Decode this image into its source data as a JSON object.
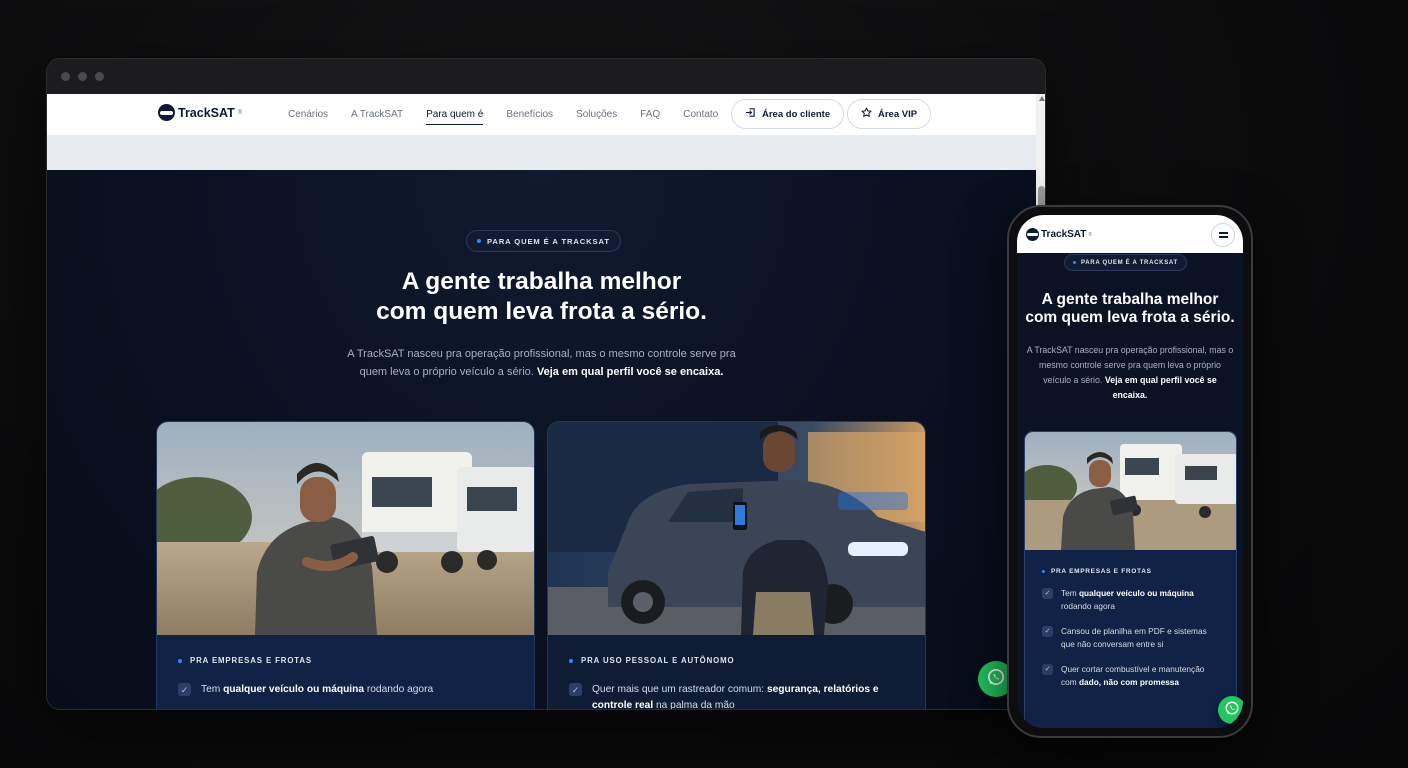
{
  "brand": {
    "name": "TrackSAT",
    "mark": "®"
  },
  "nav": {
    "links": [
      "Cenários",
      "A TrackSAT",
      "Para quem é",
      "Benefícios",
      "Soluções",
      "FAQ",
      "Contato"
    ],
    "active_index": 2,
    "client_button": "Área do cliente",
    "vip_button": "Área VIP"
  },
  "hero": {
    "pill": "PARA QUEM É A TRACKSAT",
    "headline_line1": "A gente trabalha melhor",
    "headline_line2": "com quem leva frota a sério.",
    "sub_line1": "A TrackSAT nasceu pra operação profissional, mas o mesmo controle serve pra",
    "sub_line2": "quem leva o próprio veículo a sério.",
    "sub_bold": "Veja em qual perfil você se encaixa.",
    "mobile_sub": "A TrackSAT nasceu pra operação profissional, mas o mesmo controle serve pra quem leva o próprio veículo a sério."
  },
  "cards": [
    {
      "tag": "PRA EMPRESAS E FROTAS",
      "items": [
        {
          "pre": "Tem ",
          "bold": "qualquer veículo ou máquina",
          "post": " rodando agora"
        },
        {
          "pre": "Cansou de planilha em PDF e sistemas que não conversam entre si",
          "bold": "",
          "post": ""
        },
        {
          "pre": "Quer cortar combustível e manutenção com ",
          "bold": "dado, não com promessa",
          "post": ""
        }
      ]
    },
    {
      "tag": "PRA USO PESSOAL E AUTÔNOMO",
      "items": [
        {
          "pre": "Quer mais que um rastreador comum: ",
          "bold": "segurança, relatórios e controle real",
          "post": " na palma da mão"
        }
      ]
    }
  ],
  "icons": {
    "check": "check-icon",
    "whatsapp": "whatsapp-icon",
    "login": "login-icon",
    "star": "star-icon",
    "menu": "hamburger-menu-icon"
  },
  "colors": {
    "navy": "#0d1b3a",
    "accent_blue": "#3b82f6",
    "whatsapp_green": "#22c55e",
    "section_bg": "#0a1020",
    "card_bg": "#102246"
  }
}
